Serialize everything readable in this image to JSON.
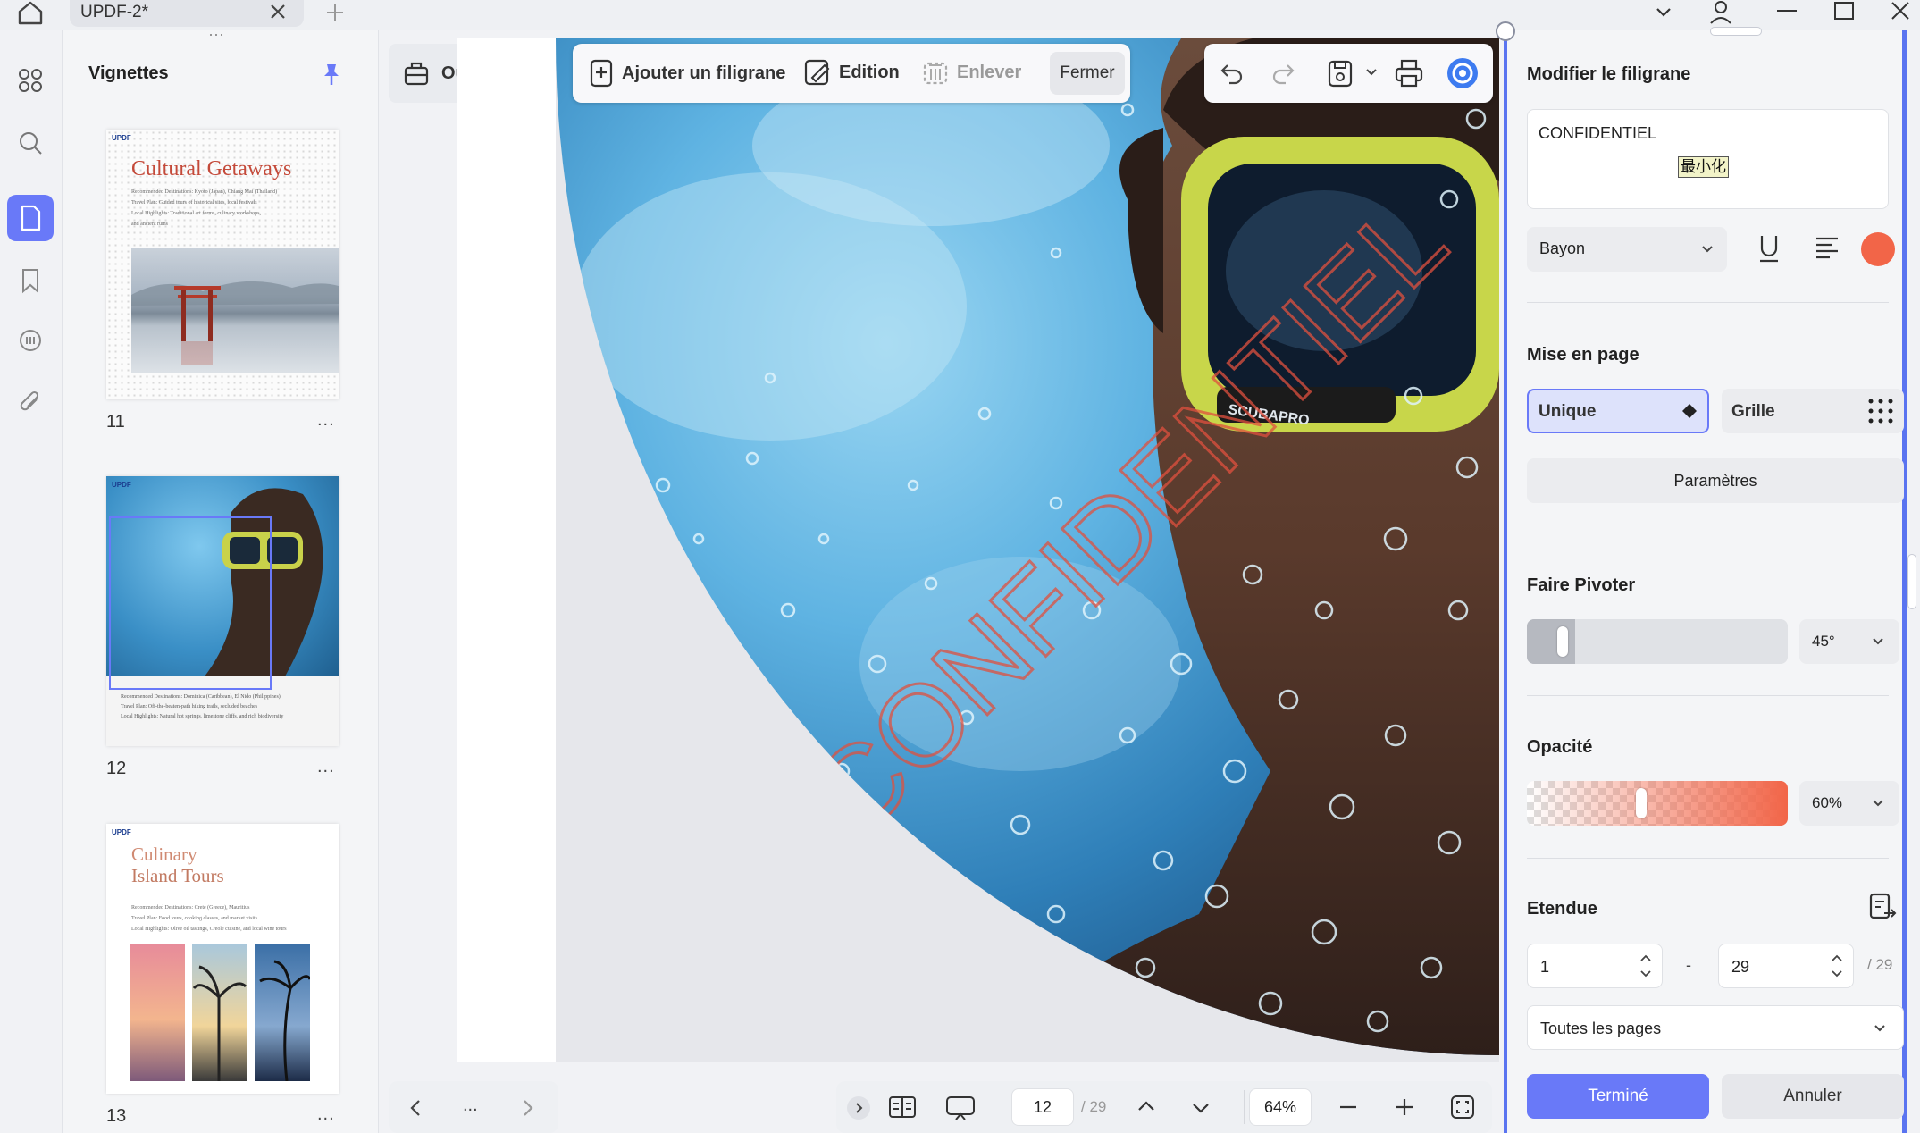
{
  "app": {
    "tab_title": "UPDF-2*",
    "colors": {
      "accent": "#6979f8",
      "panel_border": "#5a74f0",
      "watermark": "#e0503e"
    }
  },
  "thumbnails": {
    "title": "Vignettes",
    "pages": [
      {
        "number": "11",
        "logo": "UPDF",
        "heading": "Cultural Getaways",
        "lines": [
          "Recommended Destinations: Kyoto (Japan), Chiang Mai (Thailand)",
          "Travel Plan: Guided tours of historical sites, local festivals",
          "Local Highlights: Traditional art forms, culinary workshops,",
          "and ancient ruins"
        ]
      },
      {
        "number": "12",
        "logo": "UPDF",
        "lines": [
          "Recommended Destinations: Dominica (Caribbean), El Nido (Philippines)",
          "Travel Plan: Off-the-beaten-path hiking trails, secluded beaches",
          "Local Highlights: Natural hot springs, limestone cliffs, and rich biodiversity"
        ]
      },
      {
        "number": "13",
        "logo": "UPDF",
        "heading_a": "Culinary",
        "heading_b": "Island Tours",
        "lines": [
          "Recommended Destinations: Crete (Greece), Mauritius",
          "Travel Plan: Food tours, cooking classes, and market visits",
          "Local Highlights: Olive oil tastings, Creole cuisine, and local wine tours"
        ]
      }
    ],
    "more": "..."
  },
  "tools": {
    "outils_label": "Outils"
  },
  "watermark_toolbar": {
    "add": "Ajouter un filigrane",
    "edit": "Edition",
    "remove": "Enlever",
    "close": "Fermer"
  },
  "document": {
    "watermark_text": "CONFIDENTIEL",
    "photo_label": "SCUBAPRO"
  },
  "panel": {
    "title": "Modifier le filigrane",
    "text_value": "CONFIDENTIEL",
    "ime_label": "最小化",
    "font": "Bayon",
    "layout_title": "Mise en page",
    "layout_unique": "Unique",
    "layout_grid": "Grille",
    "params": "Paramètres",
    "rotate_title": "Faire Pivoter",
    "rotate_value": "45°",
    "rotate_level": 0.05,
    "opacity_title": "Opacité",
    "opacity_value": "60%",
    "opacity_level": 0.6,
    "range_title": "Etendue",
    "range_from": "1",
    "range_dash": "-",
    "range_to": "29",
    "range_total": "/ 29",
    "pages_select": "Toutes les pages",
    "done": "Terminé",
    "cancel": "Annuler"
  },
  "bottom": {
    "nav_more": "...",
    "page_current": "12",
    "page_total": "/ 29",
    "zoom": "64%"
  }
}
